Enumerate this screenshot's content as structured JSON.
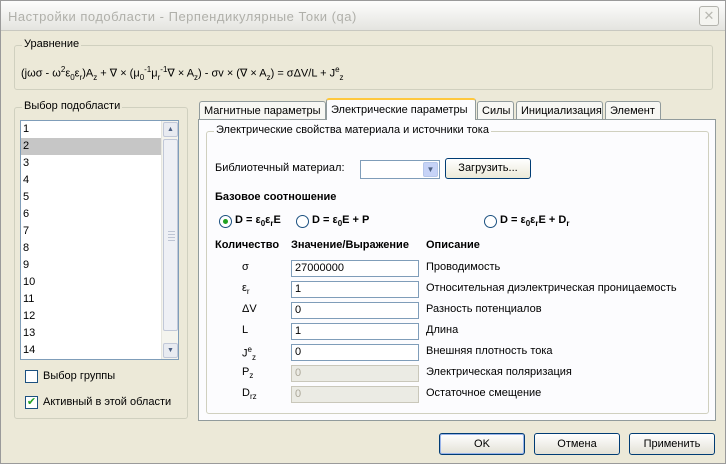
{
  "window": {
    "title": "Настройки подобласти - Перпендикулярные Токи (qa)",
    "close_label": "✕"
  },
  "equation": {
    "label": "Уравнение",
    "parts": {
      "p1": "(jωσ - ω",
      "p1s": "2",
      "p2": "ε",
      "p2s": "0",
      "p3": "ε",
      "p3s": "r",
      "p4": ")A",
      "p4s": "z",
      "p5": " + ∇ × (μ",
      "p5s": "0",
      "p5t": "-1",
      "p6": "μ",
      "p6s": "r",
      "p6t": "-1",
      "p7": "∇ × A",
      "p7s": "z",
      "p8": ") - σv × (∇ × A",
      "p8s": "z",
      "p9": ") = σΔV/L + J",
      "p9t": "e",
      "p9s": "z"
    }
  },
  "subdomain": {
    "label": "Выбор подобласти",
    "items": [
      "1",
      "2",
      "3",
      "4",
      "5",
      "6",
      "7",
      "8",
      "9",
      "10",
      "11",
      "12",
      "13",
      "14"
    ],
    "selected_index": 1,
    "group_select_label": "Выбор группы",
    "active_label": "Активный в этой области",
    "active_checked": true,
    "group_select_checked": false
  },
  "tabs": [
    {
      "label": "Магнитные параметры"
    },
    {
      "label": "Электрические параметры"
    },
    {
      "label": "Силы"
    },
    {
      "label": "Инициализация"
    },
    {
      "label": "Элемент"
    }
  ],
  "active_tab": 1,
  "panel": {
    "group_label": "Электрические свойства материала и источники тока",
    "library_label": "Библиотечный материал:",
    "library_value": "",
    "load_button": "Загрузить...",
    "relation_heading": "Базовое соотношение",
    "radios": [
      {
        "a": "D = ε",
        "as": "0",
        "b": "ε",
        "bs": "r",
        "c": "E",
        "d": "",
        "ds": "",
        "checked": true
      },
      {
        "a": "D = ε",
        "as": "0",
        "b": "",
        "bs": "",
        "c": "E + P",
        "d": "",
        "ds": "",
        "checked": false
      },
      {
        "a": "D = ε",
        "as": "0",
        "b": "ε",
        "bs": "r",
        "c": "E + D",
        "d": "",
        "ds": "r",
        "checked": false
      }
    ],
    "headers": {
      "quantity": "Количество",
      "value": "Значение/Выражение",
      "description": "Описание"
    },
    "rows": [
      {
        "sym": "σ",
        "sub": "",
        "sup": "",
        "value": "27000000",
        "desc": "Проводимость",
        "disabled": false
      },
      {
        "sym": "ε",
        "sub": "r",
        "sup": "",
        "value": "1",
        "desc": "Относительная диэлектрическая проницаемость",
        "disabled": false
      },
      {
        "sym": "ΔV",
        "sub": "",
        "sup": "",
        "value": "0",
        "desc": "Разность потенциалов",
        "disabled": false
      },
      {
        "sym": "L",
        "sub": "",
        "sup": "",
        "value": "1",
        "desc": "Длина",
        "disabled": false
      },
      {
        "sym": "J",
        "sub": "z",
        "sup": "e",
        "value": "0",
        "desc": "Внешняя плотность тока",
        "disabled": false
      },
      {
        "sym": "P",
        "sub": "z",
        "sup": "",
        "value": "0",
        "desc": "Электрическая поляризация",
        "disabled": true
      },
      {
        "sym": "D",
        "sub": "rz",
        "sup": "",
        "value": "0",
        "desc": "Остаточное смещение",
        "disabled": true
      }
    ]
  },
  "footer": {
    "ok": "OK",
    "cancel": "Отмена",
    "apply": "Применить"
  },
  "colors": {
    "selection": "#c6c6c6",
    "check": "#21a121",
    "tab_highlight": "#ffc83c"
  }
}
